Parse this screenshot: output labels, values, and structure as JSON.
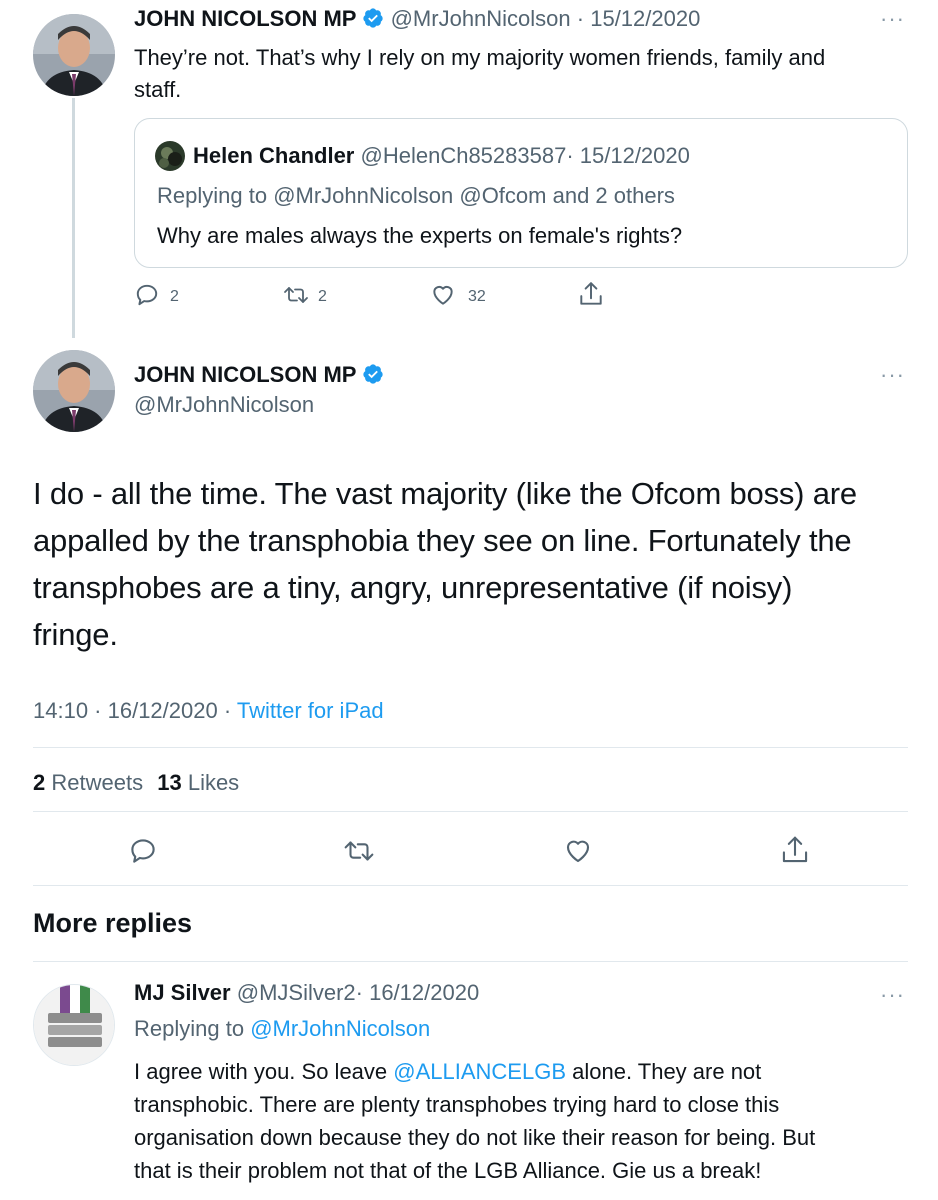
{
  "tweet1": {
    "author_name": "JOHN NICOLSON MP",
    "handle": "@MrJohnNicolson",
    "date": "· 15/12/2020",
    "text_line1": "They’re not. That’s why I rely on my majority women friends, family and",
    "text_line2": "staff.",
    "quoted": {
      "name": "Helen Chandler",
      "handle": "@HelenCh85283587",
      "date": "· 15/12/2020",
      "replying_prefix": "Replying to ",
      "replying_to": "@MrJohnNicolson @Ofcom and 2 others",
      "text": "Why are males always the experts on female's rights?"
    },
    "replies": "2",
    "retweets": "2",
    "likes": "32"
  },
  "main_tweet": {
    "author_name": "JOHN NICOLSON MP",
    "handle": "@MrJohnNicolson",
    "text_line1": "I do - all the time. The vast majority (like the Ofcom boss) are",
    "text_line2": "appalled by the transphobia they see on line. Fortunately the",
    "text_line3": "transphobes are a tiny, angry, unrepresentative (if noisy)",
    "text_line4": "fringe.",
    "time": "14:10 · 16/12/2020 · ",
    "source": "Twitter for iPad",
    "retweet_count": "2",
    "retweet_label": "Retweets",
    "like_count": "13",
    "like_label": "Likes"
  },
  "more_replies": {
    "heading": "More replies"
  },
  "reply": {
    "name": "MJ Silver",
    "handle": "@MJSilver2",
    "date": "· 16/12/2020",
    "replying_prefix": "Replying to ",
    "replying_to": "@MrJohnNicolson",
    "line1_a": "I agree with you. So leave ",
    "line1_mention": "@ALLIANCELGB",
    "line1_b": " alone. They are not",
    "line2": "transphobic. There are plenty transphobes trying hard to close this",
    "line3": "organisation down because they do not like their reason for being. But",
    "line4": "that is their problem not that of the LGB Alliance. Gie us a break!"
  },
  "colors": {
    "accent": "#1d9bf0",
    "muted": "#536471",
    "divider": "#e1e8ed"
  },
  "icons": [
    "verified-badge-icon",
    "more-options-icon",
    "reply-icon",
    "retweet-icon",
    "like-icon",
    "share-icon"
  ]
}
